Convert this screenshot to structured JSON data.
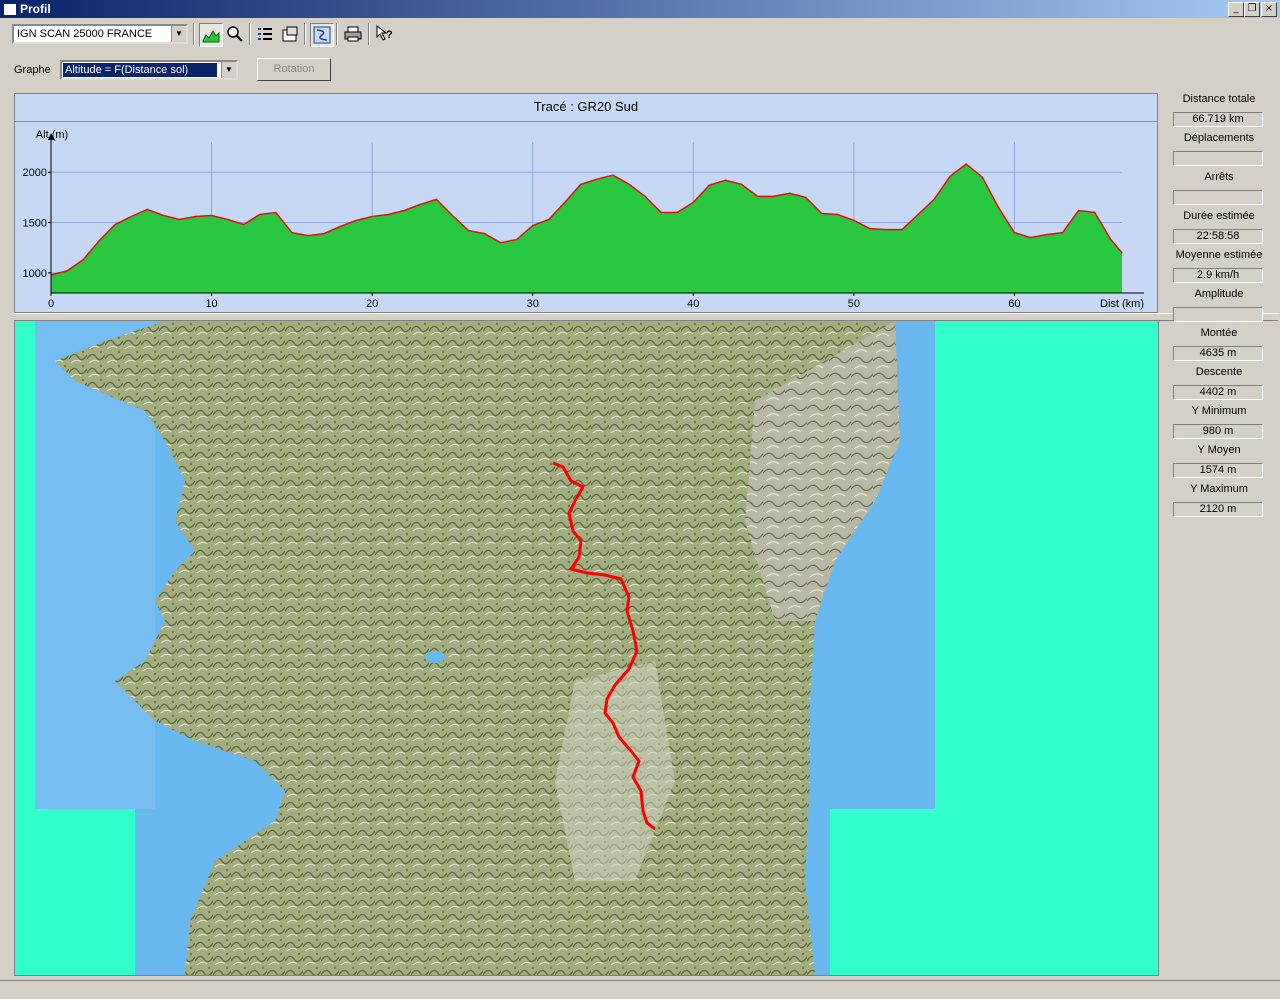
{
  "window": {
    "title": "Profil"
  },
  "toolbar": {
    "map_source": "IGN SCAN 25000 FRANCE",
    "icons": [
      "profile-icon",
      "zoom-icon",
      "list-icon",
      "properties-icon",
      "route-icon",
      "print-icon",
      "help-icon"
    ]
  },
  "graph": {
    "label": "Graphe",
    "mode": "Altitude = F(Distance sol)",
    "rotation_label": "Rotation"
  },
  "chart_data": {
    "type": "area",
    "title": "Tracé : GR20 Sud",
    "ylabel": "Alt (m)",
    "xlabel": "Dist (km)",
    "xlim": [
      0,
      66.7
    ],
    "ylim": [
      800,
      2300
    ],
    "xticks": [
      0,
      10,
      20,
      30,
      40,
      50,
      60
    ],
    "yticks": [
      1000,
      1500,
      2000
    ],
    "grid": true,
    "fill_color": "#2ac840",
    "line_color": "#e01010",
    "x": [
      0,
      1,
      2,
      3,
      4,
      5,
      6,
      7,
      8,
      9,
      10,
      11,
      12,
      13,
      14,
      15,
      16,
      17,
      18,
      19,
      20,
      21,
      22,
      23,
      24,
      25,
      26,
      27,
      28,
      29,
      30,
      31,
      32,
      33,
      34,
      35,
      36,
      37,
      38,
      39,
      40,
      41,
      42,
      43,
      44,
      45,
      46,
      47,
      48,
      49,
      50,
      51,
      52,
      53,
      54,
      55,
      56,
      57,
      58,
      59,
      60,
      61,
      62,
      63,
      64,
      65,
      66,
      66.7
    ],
    "y": [
      980,
      1020,
      1130,
      1320,
      1480,
      1560,
      1630,
      1570,
      1530,
      1560,
      1570,
      1530,
      1480,
      1580,
      1600,
      1400,
      1370,
      1390,
      1460,
      1520,
      1560,
      1580,
      1620,
      1680,
      1730,
      1570,
      1420,
      1390,
      1300,
      1330,
      1470,
      1530,
      1700,
      1880,
      1930,
      1970,
      1880,
      1760,
      1600,
      1600,
      1700,
      1870,
      1920,
      1880,
      1760,
      1760,
      1790,
      1750,
      1590,
      1580,
      1520,
      1440,
      1430,
      1430,
      1580,
      1730,
      1960,
      2080,
      1950,
      1650,
      1400,
      1350,
      1380,
      1400,
      1620,
      1600,
      1330,
      1200
    ],
    "series": [
      {
        "name": "",
        "values": []
      }
    ]
  },
  "stats": [
    {
      "label": "Distance totale",
      "value": "66.719 km"
    },
    {
      "label": "Déplacements",
      "value": ""
    },
    {
      "label": "Arrêts",
      "value": ""
    },
    {
      "label": "Durée estimée",
      "value": "22:58:58"
    },
    {
      "label": "Moyenne estimée",
      "value": "2.9 km/h"
    },
    {
      "label": "Amplitude",
      "value": ""
    },
    {
      "label": "Montée",
      "value": "4635 m"
    },
    {
      "label": "Descente",
      "value": "4402 m"
    },
    {
      "label": "Y Minimum",
      "value": "980 m"
    },
    {
      "label": "Y Moyen",
      "value": "1574 m"
    },
    {
      "label": "Y Maximum",
      "value": "2120 m"
    }
  ],
  "colors": {
    "map_background": "#33ffcc",
    "sea": "#6ab8f0",
    "terrain": "#9aa878",
    "track": "#ff0000"
  }
}
